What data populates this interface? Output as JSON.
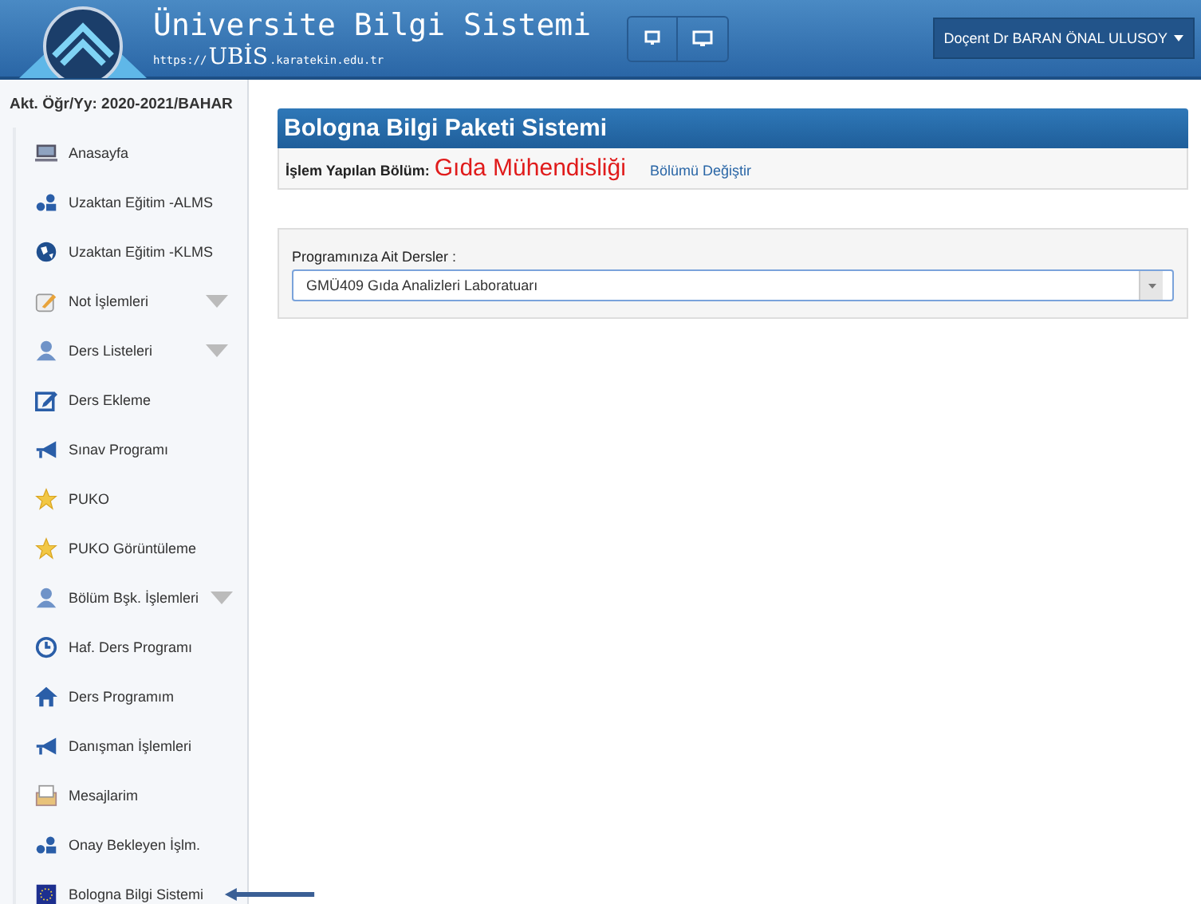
{
  "header": {
    "title": "Üniversite Bilgi Sistemi",
    "url_prefix": "https://",
    "url_brand": "UBİS",
    "url_suffix": ".karatekin.edu.tr",
    "user_menu": "Doçent Dr BARAN ÖNAL ULUSOY"
  },
  "sidebar": {
    "term": "Akt. Öğr/Yy: 2020-2021/BAHAR",
    "items": [
      {
        "label": "Anasayfa",
        "expandable": false
      },
      {
        "label": "Uzaktan Eğitim -ALMS",
        "expandable": false
      },
      {
        "label": "Uzaktan Eğitim -KLMS",
        "expandable": false
      },
      {
        "label": "Not İşlemleri",
        "expandable": true
      },
      {
        "label": "Ders Listeleri",
        "expandable": true
      },
      {
        "label": "Ders Ekleme",
        "expandable": false
      },
      {
        "label": "Sınav Programı",
        "expandable": false
      },
      {
        "label": "PUKO",
        "expandable": false
      },
      {
        "label": "PUKO Görüntüleme",
        "expandable": false
      },
      {
        "label": "Bölüm Bşk. İşlemleri",
        "expandable": true
      },
      {
        "label": "Haf. Ders Programı",
        "expandable": false
      },
      {
        "label": "Ders Programım",
        "expandable": false
      },
      {
        "label": "Danışman İşlemleri",
        "expandable": false
      },
      {
        "label": "Mesajlarim",
        "expandable": false
      },
      {
        "label": "Onay Bekleyen İşlm.",
        "expandable": false
      },
      {
        "label": "Bologna Bilgi Sistemi",
        "expandable": false
      }
    ]
  },
  "panel": {
    "title": "Bologna Bilgi Paketi Sistemi",
    "department_label": "İşlem Yapılan Bölüm:",
    "department": "Gıda Mühendisliği",
    "change_link": "Bölümü Değiştir"
  },
  "course_form": {
    "label": "Programınıza Ait Dersler :",
    "value": "GMÜ409 Gıda Analizleri Laboratuarı"
  }
}
